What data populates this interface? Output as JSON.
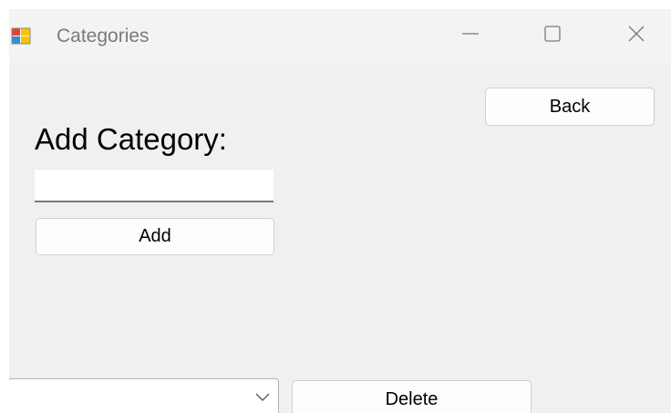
{
  "window": {
    "title": "Categories",
    "icon": "winforms-app-icon",
    "controls": [
      "minimize-icon",
      "maximize-icon",
      "close-icon"
    ]
  },
  "form": {
    "heading": "Add Category:",
    "category_input": {
      "value": "",
      "placeholder": ""
    },
    "add_label": "Add",
    "back_label": "Back",
    "category_select": {
      "selected": ""
    },
    "delete_label": "Delete"
  },
  "colors": {
    "window_background": "#f0f0f0",
    "titlebar_background": "#f3f3f3",
    "title_text": "#7a7a7a",
    "button_background": "#fdfdfd",
    "button_border": "#d0d0d0"
  }
}
